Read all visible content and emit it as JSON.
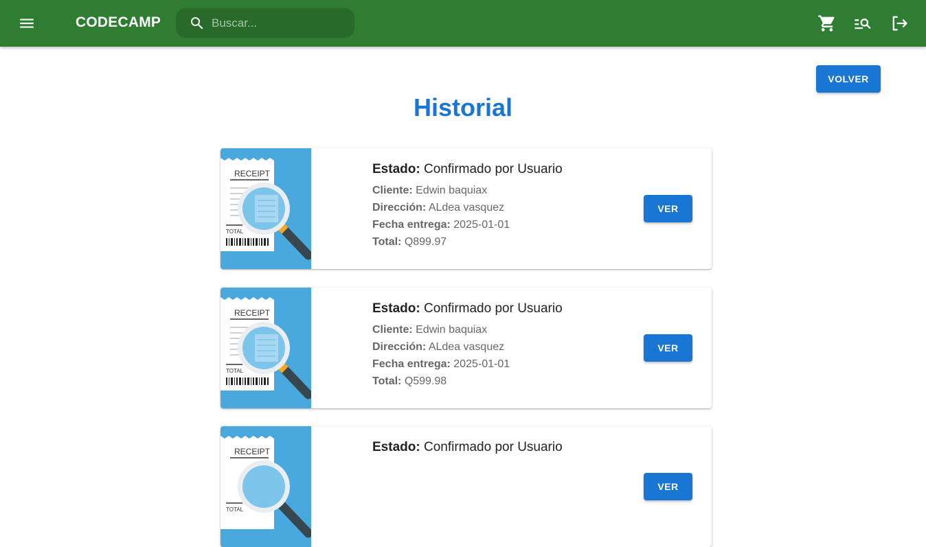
{
  "header": {
    "menu_icon": "menu-icon",
    "brand": "CODECAMP",
    "search_placeholder": "Buscar...",
    "search_value": "",
    "actions": [
      {
        "name": "cart-icon"
      },
      {
        "name": "manage-search-icon"
      },
      {
        "name": "logout-icon"
      }
    ],
    "color": "#2e7d32"
  },
  "page": {
    "back_label": "VOLVER",
    "title": "Historial",
    "accent_color": "#1976d2"
  },
  "orders": [
    {
      "image_text": "RECEIPT",
      "image_total": "TOTAL",
      "estado_label": "Estado:",
      "estado_value": "Confirmado por Usuario",
      "cliente_label": "Cliente:",
      "cliente_value": "Edwin baquiax",
      "direccion_label": "Dirección:",
      "direccion_value": "ALdea vasquez",
      "fecha_label": "Fecha entrega:",
      "fecha_value": "2025-01-01",
      "total_label": "Total:",
      "total_value": "Q899.97",
      "button_label": "VER"
    },
    {
      "image_text": "RECEIPT",
      "image_total": "TOTAL",
      "estado_label": "Estado:",
      "estado_value": "Confirmado por Usuario",
      "cliente_label": "Cliente:",
      "cliente_value": "Edwin baquiax",
      "direccion_label": "Dirección:",
      "direccion_value": "ALdea vasquez",
      "fecha_label": "Fecha entrega:",
      "fecha_value": "2025-01-01",
      "total_label": "Total:",
      "total_value": "Q599.98",
      "button_label": "VER"
    },
    {
      "image_text": "RECEIPT",
      "image_total": "TOTAL",
      "estado_label": "Estado:",
      "estado_value": "Confirmado por Usuario",
      "button_label": "VER"
    }
  ]
}
